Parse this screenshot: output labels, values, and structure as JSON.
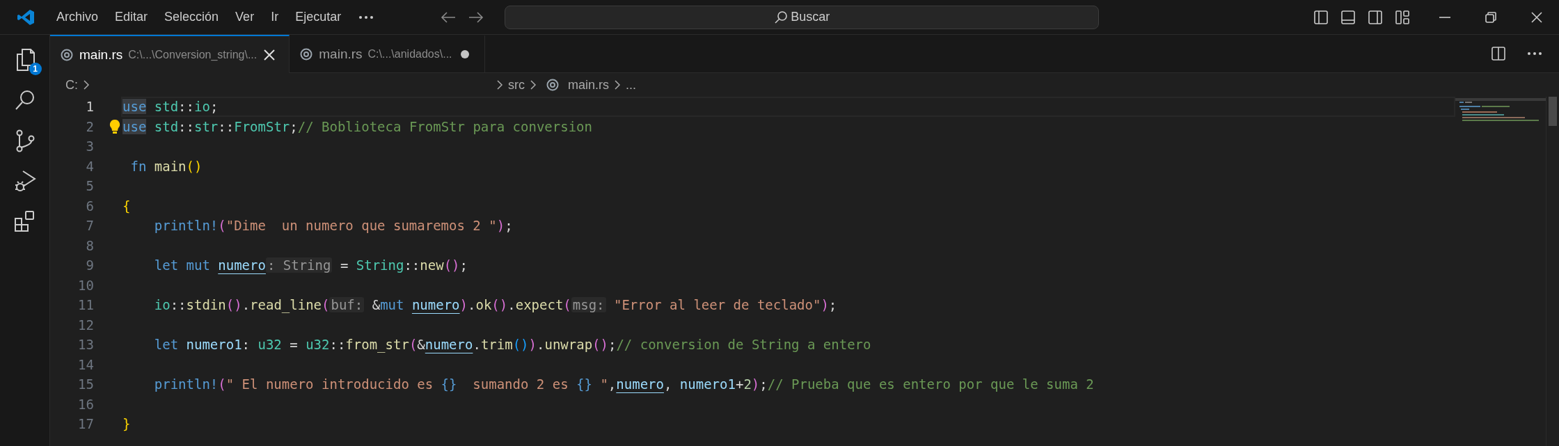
{
  "menu": [
    {
      "label": "Archivo"
    },
    {
      "label": "Editar"
    },
    {
      "label": "Selección"
    },
    {
      "label": "Ver"
    },
    {
      "label": "Ir"
    },
    {
      "label": "Ejecutar"
    }
  ],
  "search": {
    "placeholder": "Buscar"
  },
  "activity_bar": [
    {
      "kind": "explorer",
      "badge": "1"
    },
    {
      "kind": "search"
    },
    {
      "kind": "scm"
    },
    {
      "kind": "debug"
    },
    {
      "kind": "extensions"
    }
  ],
  "tabs": [
    {
      "label": "main.rs",
      "path": "C:\\...\\Conversion_string\\...",
      "selected": true,
      "modified": false
    },
    {
      "label": "main.rs",
      "path": "C:\\...\\anidados\\...",
      "selected": false,
      "modified": true
    }
  ],
  "breadcrumbs": [
    {
      "label": "C:",
      "kind": "folder"
    },
    {
      "label": "src",
      "kind": "folder"
    },
    {
      "label": "main.rs",
      "kind": "file"
    },
    {
      "label": "...",
      "kind": "symbol"
    }
  ],
  "lines": [
    {
      "number": "1",
      "active": true,
      "lightbulb": false,
      "tokens": [
        {
          "kind": "keyword_highlighted",
          "text": "use"
        },
        {
          "kind": "type",
          "text": " std"
        },
        {
          "kind": "punct",
          "text": "::"
        },
        {
          "kind": "type",
          "text": "io"
        },
        {
          "kind": "punct",
          "text": ";"
        }
      ]
    },
    {
      "number": "2",
      "active": false,
      "lightbulb": true,
      "tokens": [
        {
          "kind": "keyword_highlighted",
          "text": "use"
        },
        {
          "kind": "type",
          "text": " std"
        },
        {
          "kind": "punct",
          "text": "::"
        },
        {
          "kind": "type",
          "text": "str"
        },
        {
          "kind": "punct",
          "text": "::"
        },
        {
          "kind": "type",
          "text": "FromStr"
        },
        {
          "kind": "punct",
          "text": ";"
        },
        {
          "kind": "comment",
          "text": "// Boblioteca FromStr para conversion"
        }
      ]
    },
    {
      "number": "3",
      "active": false,
      "lightbulb": false
    },
    {
      "number": "4",
      "active": false,
      "lightbulb": false,
      "tokens": [
        {
          "kind": "keyword",
          "text": " fn "
        },
        {
          "kind": "function",
          "text": "main"
        },
        {
          "kind": "bracket1",
          "text": "()"
        }
      ]
    },
    {
      "number": "5",
      "active": false,
      "lightbulb": false
    },
    {
      "number": "6",
      "active": false,
      "lightbulb": false,
      "tokens": [
        {
          "kind": "bracket1",
          "text": "{"
        }
      ]
    },
    {
      "number": "7",
      "active": false,
      "lightbulb": false,
      "tokens": [
        {
          "kind": "macro",
          "text": "    println!"
        },
        {
          "kind": "bracket2",
          "text": "("
        },
        {
          "kind": "string",
          "text": "\"Dime  un numero que sumaremos 2 \""
        },
        {
          "kind": "bracket2",
          "text": ")"
        },
        {
          "kind": "punct",
          "text": ";"
        }
      ]
    },
    {
      "number": "8",
      "active": false,
      "lightbulb": false
    },
    {
      "number": "9",
      "active": false,
      "lightbulb": false,
      "tokens": [
        {
          "kind": "keyword",
          "text": "    let mut "
        },
        {
          "kind": "mutable",
          "text": "numero"
        },
        {
          "kind": "hint",
          "text": ": String"
        },
        {
          "kind": "punct",
          "text": " = "
        },
        {
          "kind": "type",
          "text": "String"
        },
        {
          "kind": "punct",
          "text": "::"
        },
        {
          "kind": "function",
          "text": "new"
        },
        {
          "kind": "bracket2",
          "text": "()"
        },
        {
          "kind": "punct",
          "text": ";"
        }
      ]
    },
    {
      "number": "10",
      "active": false,
      "lightbulb": false
    },
    {
      "number": "11",
      "active": false,
      "lightbulb": false,
      "tokens": [
        {
          "kind": "type",
          "text": "    io"
        },
        {
          "kind": "punct",
          "text": "::"
        },
        {
          "kind": "function",
          "text": "stdin"
        },
        {
          "kind": "bracket2",
          "text": "()"
        },
        {
          "kind": "punct",
          "text": "."
        },
        {
          "kind": "function",
          "text": "read_line"
        },
        {
          "kind": "bracket2",
          "text": "("
        },
        {
          "kind": "hint",
          "text": "buf:"
        },
        {
          "kind": "punct",
          "text": " &"
        },
        {
          "kind": "keyword",
          "text": "mut "
        },
        {
          "kind": "mutable",
          "text": "numero"
        },
        {
          "kind": "bracket2",
          "text": ")"
        },
        {
          "kind": "punct",
          "text": "."
        },
        {
          "kind": "function",
          "text": "ok"
        },
        {
          "kind": "bracket2",
          "text": "()"
        },
        {
          "kind": "punct",
          "text": "."
        },
        {
          "kind": "function",
          "text": "expect"
        },
        {
          "kind": "bracket2",
          "text": "("
        },
        {
          "kind": "hint",
          "text": "msg:"
        },
        {
          "kind": "string",
          "text": " \"Error al leer de teclado\""
        },
        {
          "kind": "bracket2",
          "text": ")"
        },
        {
          "kind": "punct",
          "text": ";"
        }
      ]
    },
    {
      "number": "12",
      "active": false,
      "lightbulb": false
    },
    {
      "number": "13",
      "active": false,
      "lightbulb": false,
      "tokens": [
        {
          "kind": "keyword",
          "text": "    let "
        },
        {
          "kind": "variable",
          "text": "numero1"
        },
        {
          "kind": "punct",
          "text": ": "
        },
        {
          "kind": "type",
          "text": "u32"
        },
        {
          "kind": "punct",
          "text": " = "
        },
        {
          "kind": "type",
          "text": "u32"
        },
        {
          "kind": "punct",
          "text": "::"
        },
        {
          "kind": "function",
          "text": "from_str"
        },
        {
          "kind": "bracket2",
          "text": "("
        },
        {
          "kind": "punct",
          "text": "&"
        },
        {
          "kind": "mutable",
          "text": "numero"
        },
        {
          "kind": "punct",
          "text": "."
        },
        {
          "kind": "function",
          "text": "trim"
        },
        {
          "kind": "bracket3",
          "text": "()"
        },
        {
          "kind": "bracket2",
          "text": ")"
        },
        {
          "kind": "punct",
          "text": "."
        },
        {
          "kind": "function",
          "text": "unwrap"
        },
        {
          "kind": "bracket2",
          "text": "()"
        },
        {
          "kind": "punct",
          "text": ";"
        },
        {
          "kind": "comment",
          "text": "// conversion de String a entero"
        }
      ]
    },
    {
      "number": "14",
      "active": false,
      "lightbulb": false
    },
    {
      "number": "15",
      "active": false,
      "lightbulb": false,
      "tokens": [
        {
          "kind": "macro",
          "text": "    println!"
        },
        {
          "kind": "bracket2",
          "text": "("
        },
        {
          "kind": "string",
          "text": "\" El numero introducido es "
        },
        {
          "kind": "format",
          "text": "{}"
        },
        {
          "kind": "string",
          "text": "  sumando 2 es "
        },
        {
          "kind": "format",
          "text": "{}"
        },
        {
          "kind": "string",
          "text": " \""
        },
        {
          "kind": "punct",
          "text": ","
        },
        {
          "kind": "mutable",
          "text": "numero"
        },
        {
          "kind": "punct",
          "text": ", "
        },
        {
          "kind": "variable",
          "text": "numero1"
        },
        {
          "kind": "punct",
          "text": "+"
        },
        {
          "kind": "number",
          "text": "2"
        },
        {
          "kind": "bracket2",
          "text": ")"
        },
        {
          "kind": "punct",
          "text": ";"
        },
        {
          "kind": "comment",
          "text": "// Prueba que es entero por que le suma 2"
        }
      ]
    },
    {
      "number": "16",
      "active": false,
      "lightbulb": false
    },
    {
      "number": "17",
      "active": false,
      "lightbulb": false,
      "tokens": [
        {
          "kind": "bracket1",
          "text": "}"
        }
      ]
    }
  ]
}
